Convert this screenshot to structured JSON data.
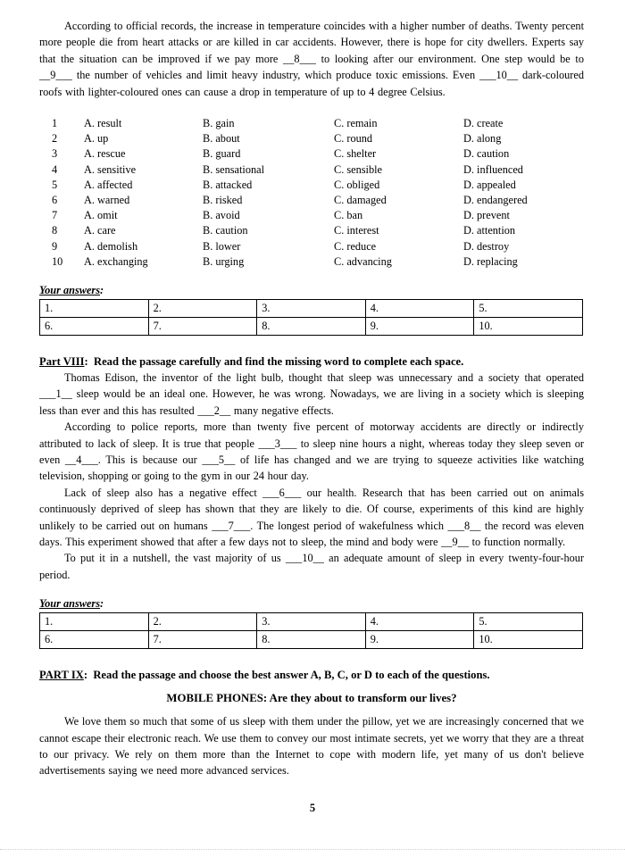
{
  "document": {
    "page_number": "5"
  },
  "cloze_passage": {
    "paragraph": "According to official records, the increase in temperature coincides with a higher number of deaths. Twenty percent more people die from heart attacks or are killed in car accidents. However, there is hope for city dwellers. Experts say that the situation can be improved if we pay more __8___ to looking after our environment. One step would be to __9___ the number of vehicles and limit heavy industry, which produce toxic emissions. Even ___10__ dark-coloured roofs with lighter-coloured ones can cause a drop in temperature of up to 4 degree Celsius."
  },
  "multiple_choice": {
    "rows": [
      {
        "num": "1",
        "a": "A. result",
        "b": "B. gain",
        "c": "C. remain",
        "d": "D. create"
      },
      {
        "num": "2",
        "a": "A. up",
        "b": "B. about",
        "c": "C. round",
        "d": "D. along"
      },
      {
        "num": "3",
        "a": "A. rescue",
        "b": "B. guard",
        "c": "C. shelter",
        "d": "D. caution"
      },
      {
        "num": "4",
        "a": "A. sensitive",
        "b": "B. sensational",
        "c": "C. sensible",
        "d": "D. influenced"
      },
      {
        "num": "5",
        "a": "A. affected",
        "b": "B. attacked",
        "c": "C. obliged",
        "d": "D. appealed"
      },
      {
        "num": "6",
        "a": "A. warned",
        "b": "B. risked",
        "c": "C. damaged",
        "d": "D. endangered"
      },
      {
        "num": "7",
        "a": "A. omit",
        "b": "B. avoid",
        "c": "C. ban",
        "d": "D. prevent"
      },
      {
        "num": "8",
        "a": "A. care",
        "b": "B. caution",
        "c": "C. interest",
        "d": "D. attention"
      },
      {
        "num": "9",
        "a": "A. demolish",
        "b": "B. lower",
        "c": "C. reduce",
        "d": "D. destroy"
      },
      {
        "num": "10",
        "a": "A. exchanging",
        "b": "B. urging",
        "c": "C. advancing",
        "d": "D. replacing"
      }
    ]
  },
  "answers_label": {
    "text": "Your answers",
    "colon": ":"
  },
  "answers_table_1": {
    "row1": [
      "1.",
      "2.",
      "3.",
      "4.",
      "5."
    ],
    "row2": [
      "6.",
      "7.",
      "8.",
      "9.",
      "10."
    ]
  },
  "answers_table_2": {
    "row1": [
      "1.",
      "2.",
      "3.",
      "4.",
      "5."
    ],
    "row2": [
      "6.",
      "7.",
      "8.",
      "9.",
      "10."
    ]
  },
  "part_viii": {
    "label": "Part VIII",
    "colon": ":",
    "instruction": "Read the passage carefully and find the missing word to complete each space.",
    "paragraph_1": "Thomas Edison, the inventor of the light bulb, thought that sleep was unnecessary and a society that operated ___1__ sleep would be an ideal one. However, he was wrong. Nowadays, we are living in a society which is sleeping less than ever and this has resulted ___2__ many negative effects.",
    "paragraph_2": "According to police reports, more than twenty five percent of motorway accidents are directly or indirectly attributed to lack of sleep. It is true that people ___3___ to sleep nine hours a night, whereas today they sleep seven or even __4___. This is because our ___5__ of life has changed and we are trying to squeeze activities like watching television, shopping or going to the gym in our 24 hour day.",
    "paragraph_3": "Lack of sleep also has a negative effect ___6___ our health. Research that has been carried out on animals continuously deprived of sleep has shown that they are likely to die. Of course, experiments of this kind are highly unlikely to be carried out on humans ___7___. The longest period of wakefulness which ___8__ the record was eleven days. This experiment showed that after a few days not to sleep, the mind and body were __9__ to function normally.",
    "paragraph_4": "To put it in a nutshell, the vast majority of us ___10__ an adequate amount of sleep in every twenty-four-hour period."
  },
  "part_ix": {
    "label": "PART IX",
    "colon": ":",
    "instruction": "Read the passage and choose the best answer A, B, C, or D to each of the questions.",
    "passage_title": "MOBILE PHONES: Are they about to transform our lives?",
    "paragraph_1": "We love them so much that some of us sleep with them under the pillow, yet we are increasingly concerned that we cannot escape their electronic reach. We use them to convey our most intimate secrets, yet we worry that they are a threat to our privacy. We rely on them more than the Internet to cope with modern life, yet many of us don't believe advertisements saying we need more advanced services."
  }
}
